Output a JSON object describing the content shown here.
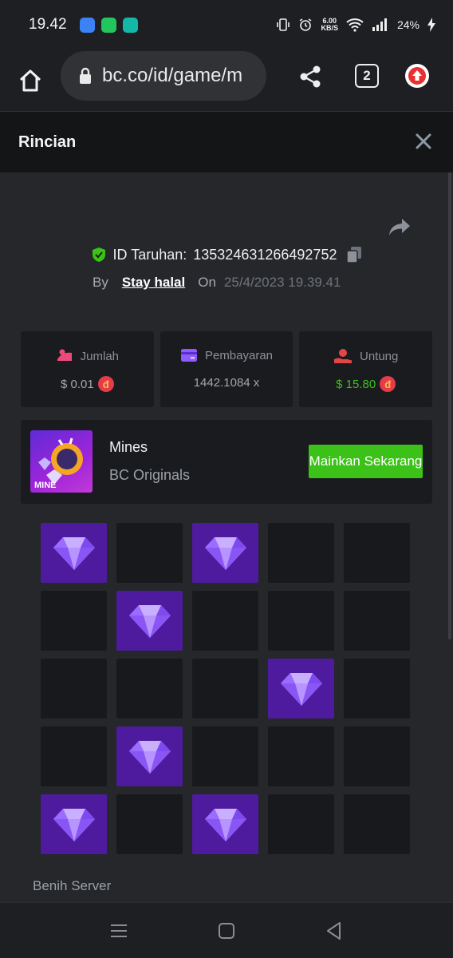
{
  "status_bar": {
    "time": "19.42",
    "net_speed_value": "6.00",
    "net_speed_unit": "KB/S",
    "battery": "24%"
  },
  "browser": {
    "url": "bc.co/id/game/m",
    "tab_count": "2"
  },
  "modal": {
    "title": "Rincian"
  },
  "bet": {
    "id_label": "ID Taruhan:",
    "id_value": "135324631266492752",
    "by_label": "By",
    "username": "Stay halal",
    "on_label": "On",
    "date": "25/4/2023 19.39.41"
  },
  "stats": [
    {
      "label": "Jumlah",
      "value": "$ 0.01",
      "icon": "money-icon",
      "color": "#ec4a7a"
    },
    {
      "label": "Pembayaran",
      "value": "1442.1084 x",
      "icon": "card-icon",
      "color": "#8e5bff"
    },
    {
      "label": "Untung",
      "value": "$ 15.80",
      "icon": "hand-coin-icon",
      "color": "#e64545"
    }
  ],
  "coin_symbol": "đ",
  "game": {
    "name": "Mines",
    "provider": "BC Originals",
    "thumb_label": "MINE",
    "play_label": "Mainkan Sekarang"
  },
  "grid": {
    "rows": 5,
    "cols": 5,
    "gems": [
      0,
      2,
      6,
      13,
      16,
      20,
      22
    ]
  },
  "server_seed_label": "Benih Server",
  "colors": {
    "accent_green": "#3bc117",
    "gem_tile": "#4e1b9e",
    "panel": "#1a1b1e",
    "background": "#25272b"
  }
}
